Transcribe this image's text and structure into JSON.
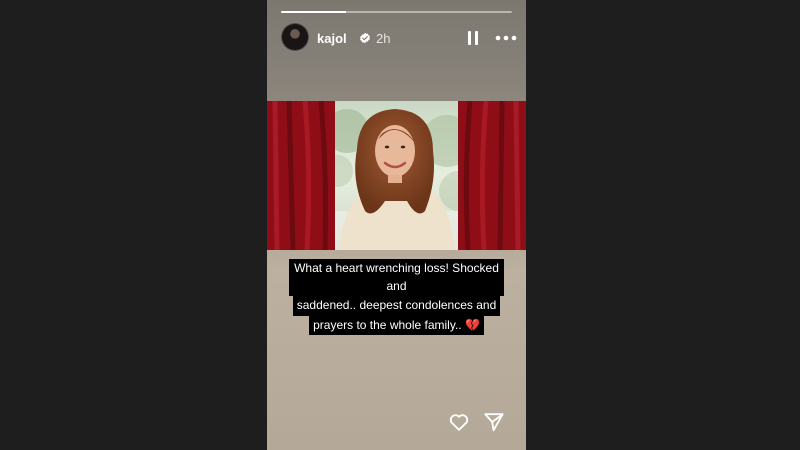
{
  "story": {
    "progress": 0.28,
    "user": {
      "username": "kajol",
      "verified": true,
      "time_ago": "2h"
    },
    "controls": {
      "pause_icon": "pause-icon",
      "more_icon": "more-icon"
    },
    "caption_lines": [
      "What a heart wrenching loss! Shocked and",
      "saddened.. deepest condolences and",
      "prayers to the whole family.. 💔"
    ],
    "actions": {
      "like_icon": "heart-icon",
      "share_icon": "send-icon"
    }
  },
  "colors": {
    "background": "#1e1e1e",
    "curtain": "#8e0d17",
    "caption_bg": "#000000"
  }
}
